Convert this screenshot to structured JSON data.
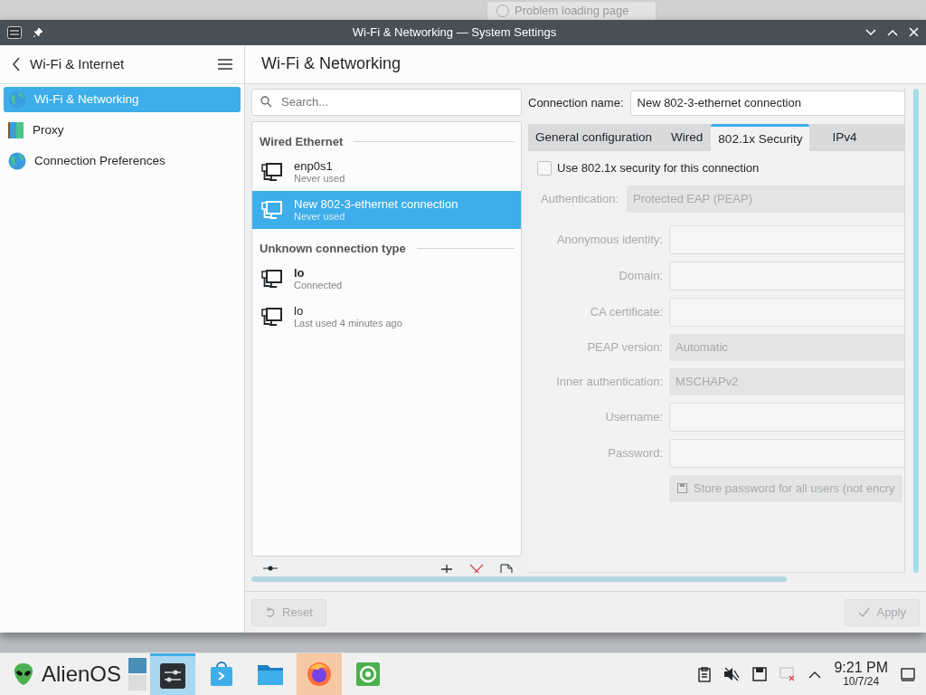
{
  "background_tab": {
    "title": "Problem loading page"
  },
  "window": {
    "title": "Wi-Fi & Networking — System Settings"
  },
  "sidebar": {
    "back_label": "Wi-Fi & Internet",
    "items": [
      {
        "label": "Wi-Fi & Networking",
        "kind": "globe",
        "selected": true
      },
      {
        "label": "Proxy",
        "kind": "proxy",
        "selected": false
      },
      {
        "label": "Connection Preferences",
        "kind": "globe",
        "selected": false
      }
    ]
  },
  "page_title": "Wi-Fi & Networking",
  "search": {
    "placeholder": "Search..."
  },
  "connection_groups": [
    {
      "title": "Wired Ethernet",
      "connections": [
        {
          "name": "enp0s1",
          "status": "Never used",
          "selected": false,
          "bold": false
        },
        {
          "name": "New 802-3-ethernet connection",
          "status": "Never used",
          "selected": true,
          "bold": false
        }
      ]
    },
    {
      "title": "Unknown connection type",
      "connections": [
        {
          "name": "lo",
          "status": "Connected",
          "selected": false,
          "bold": true
        },
        {
          "name": "lo",
          "status": "Last used 4 minutes ago",
          "selected": false,
          "bold": false
        }
      ]
    }
  ],
  "connection_name": {
    "label": "Connection name:",
    "value": "New 802-3-ethernet connection"
  },
  "tabs": [
    {
      "label": "General configuration",
      "selected": false
    },
    {
      "label": "Wired",
      "selected": false
    },
    {
      "label": "802.1x Security",
      "selected": true
    },
    {
      "label": "IPv4",
      "selected": false
    }
  ],
  "security": {
    "use_security": {
      "label": "Use 802.1x security for this connection",
      "checked": false
    },
    "authentication": {
      "label": "Authentication:",
      "value": "Protected EAP (PEAP)"
    },
    "fields": [
      {
        "label": "Anonymous identity:",
        "kind": "text"
      },
      {
        "label": "Domain:",
        "kind": "text"
      },
      {
        "label": "CA certificate:",
        "kind": "text"
      },
      {
        "label": "PEAP version:",
        "kind": "combo",
        "value": "Automatic"
      },
      {
        "label": "Inner authentication:",
        "kind": "combo",
        "value": "MSCHAPv2"
      },
      {
        "label": "Username:",
        "kind": "text"
      },
      {
        "label": "Password:",
        "kind": "text"
      }
    ],
    "store_password": {
      "label": "Store password for all users (not encry"
    }
  },
  "footer": {
    "reset": {
      "label": "Reset",
      "disabled": true
    },
    "apply": {
      "label": "Apply",
      "disabled": true
    }
  },
  "taskbar": {
    "launcher_label": "AlienOS",
    "apps": [
      {
        "kind": "settings",
        "active": true,
        "attention": false
      },
      {
        "kind": "store",
        "active": false,
        "attention": false
      },
      {
        "kind": "files",
        "active": false,
        "attention": false
      },
      {
        "kind": "browser",
        "active": false,
        "attention": true
      },
      {
        "kind": "terminal",
        "active": false,
        "attention": false
      }
    ],
    "time": "9:21 PM",
    "date": "10/7/24"
  }
}
